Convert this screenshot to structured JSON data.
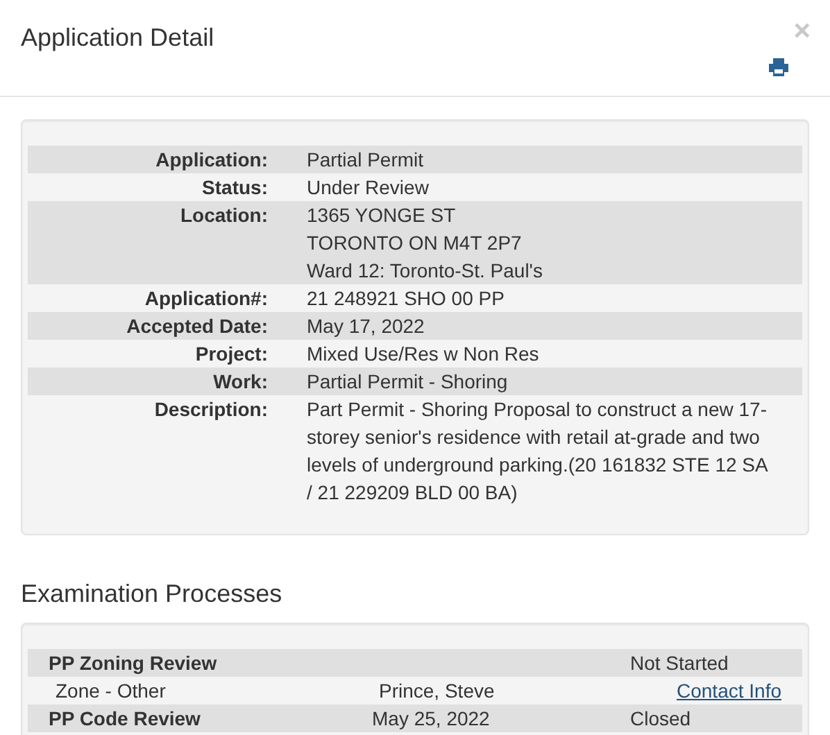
{
  "modal": {
    "title": "Application Detail",
    "close": "×"
  },
  "details": [
    {
      "label": "Application:",
      "lines": [
        "Partial Permit"
      ]
    },
    {
      "label": "Status:",
      "lines": [
        "Under Review"
      ]
    },
    {
      "label": "Location:",
      "lines": [
        "1365 YONGE ST",
        "TORONTO ON M4T 2P7",
        "Ward 12: Toronto-St. Paul's"
      ]
    },
    {
      "label": "Application#:",
      "lines": [
        "21 248921 SHO 00 PP"
      ]
    },
    {
      "label": "Accepted Date:",
      "lines": [
        "May 17, 2022"
      ]
    },
    {
      "label": "Project:",
      "lines": [
        "Mixed Use/Res w Non Res"
      ]
    },
    {
      "label": "Work:",
      "lines": [
        "Partial Permit - Shoring"
      ]
    },
    {
      "label": "Description:",
      "lines": [
        "Part Permit - Shoring Proposal to construct a new 17-storey senior's residence with retail at-grade and two levels of underground parking.(20 161832 STE 12 SA / 21 229209 BLD 00 BA)"
      ]
    }
  ],
  "examination": {
    "title": "Examination Processes",
    "rows": [
      {
        "kind": "process",
        "name": "PP Zoning Review",
        "status": "Not Started"
      },
      {
        "kind": "task",
        "name": "Zone - Other",
        "examiner": "Prince, Steve",
        "link": "Contact Info"
      },
      {
        "kind": "process",
        "name": "PP Code Review",
        "date": "May 25, 2022",
        "status": "Closed"
      }
    ]
  }
}
